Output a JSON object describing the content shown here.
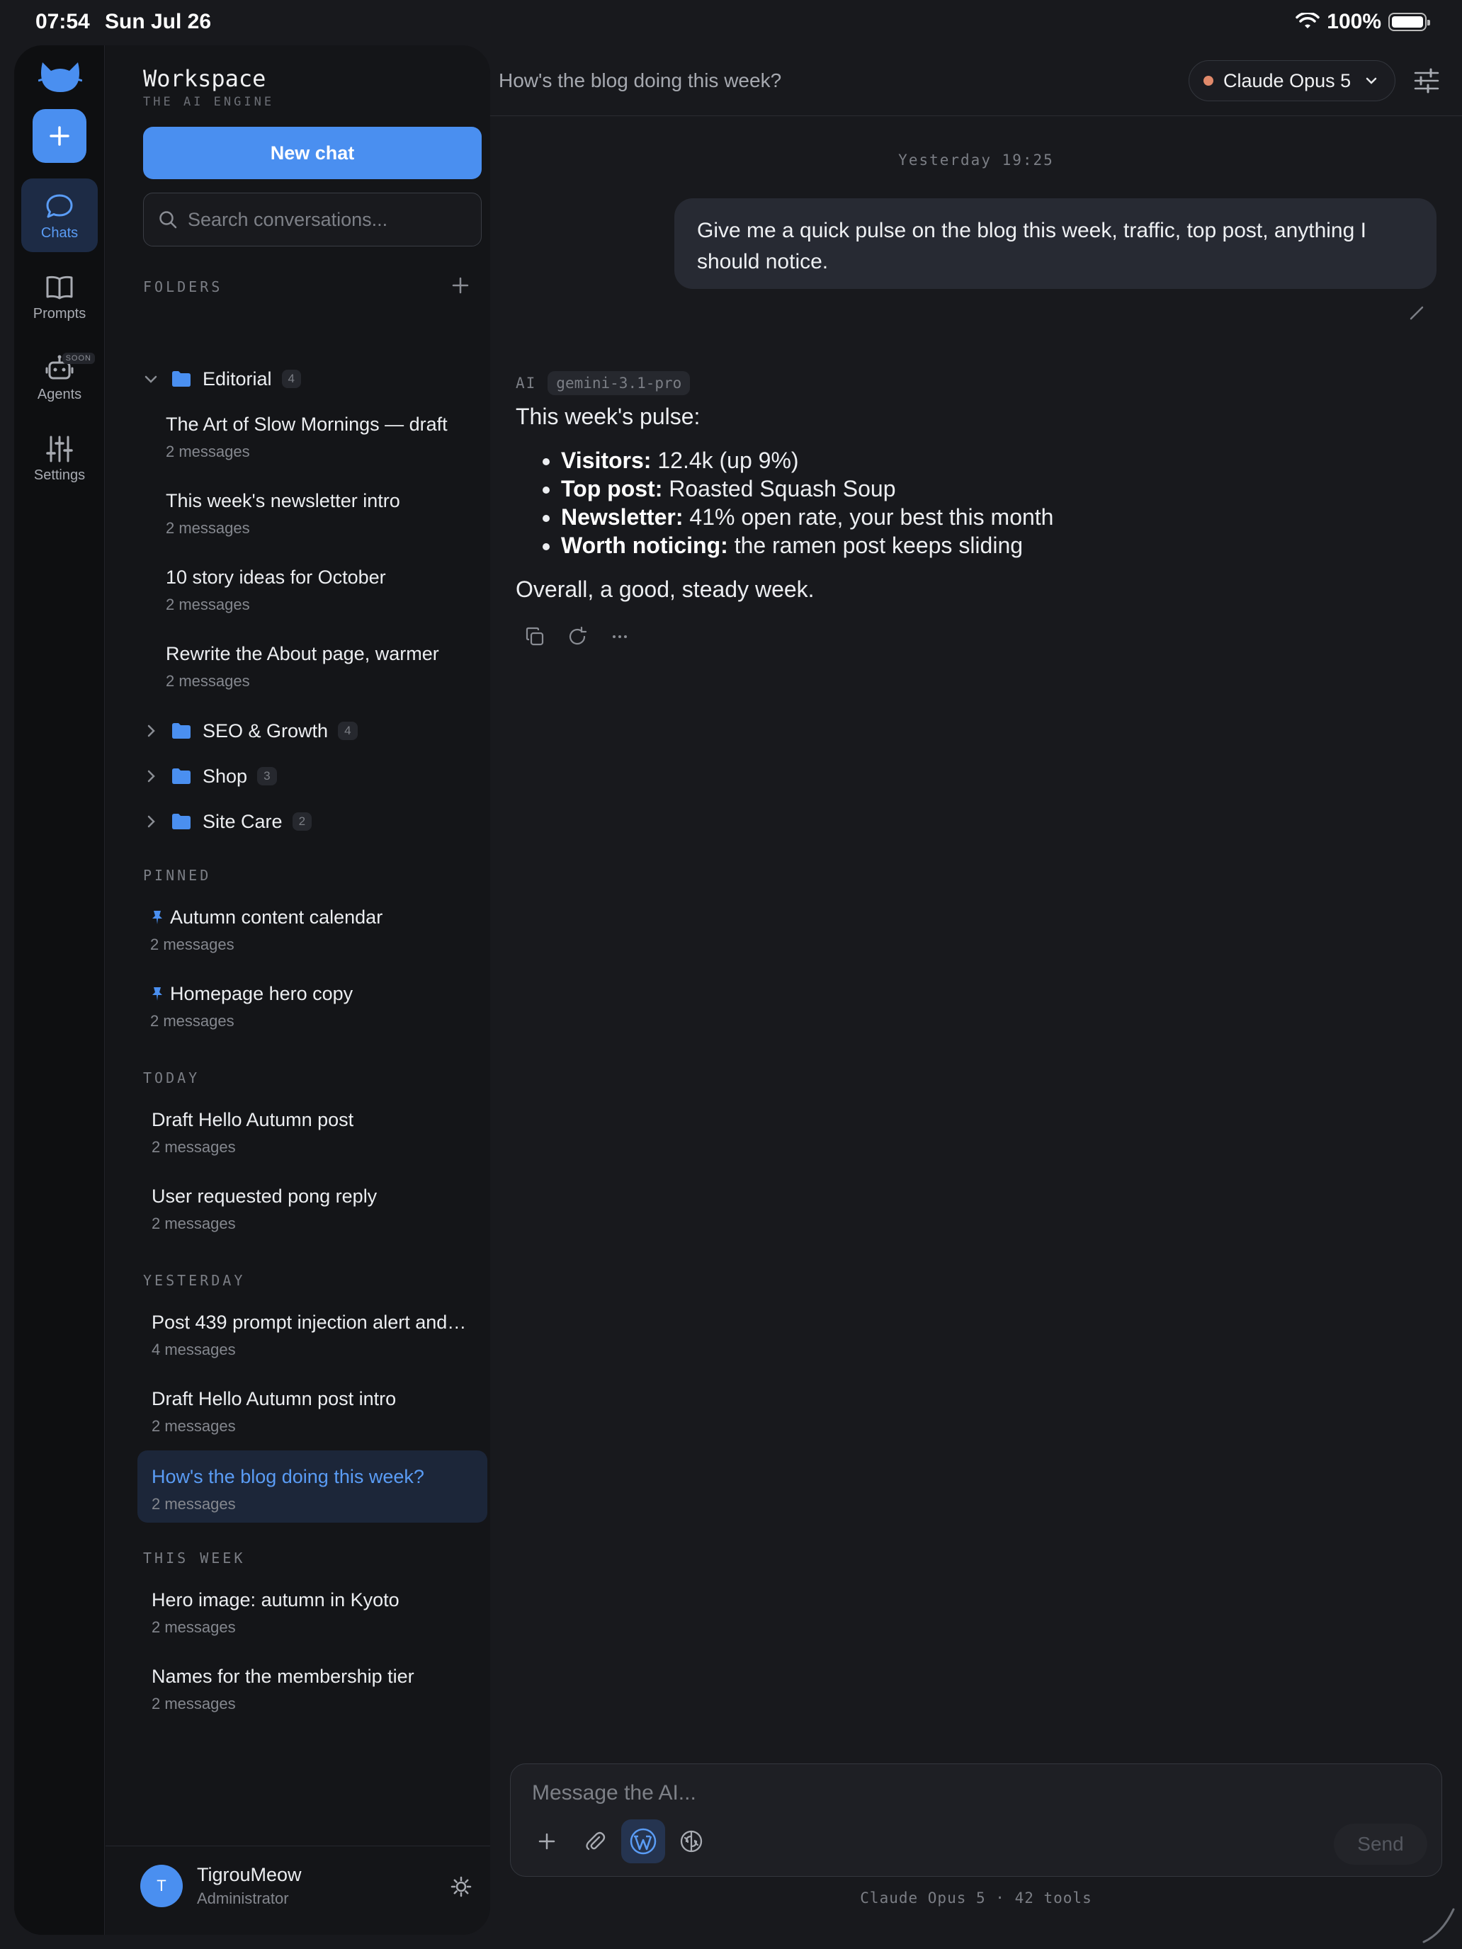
{
  "status_bar": {
    "time": "07:54",
    "date": "Sun Jul 26",
    "battery_text": "100%",
    "battery_level": 1.0
  },
  "rail": {
    "items": [
      {
        "label": "Chats",
        "icon": "chat-bubble-icon",
        "active": true
      },
      {
        "label": "Prompts",
        "icon": "book-icon"
      },
      {
        "label": "Agents",
        "icon": "robot-icon",
        "badge": "SOON"
      },
      {
        "label": "Settings",
        "icon": "sliders-icon"
      }
    ]
  },
  "sidebar": {
    "workspace_title": "Workspace",
    "workspace_subtitle": "THE AI ENGINE",
    "new_chat_label": "New chat",
    "search_placeholder": "Search conversations...",
    "folders_label": "FOLDERS",
    "folders": [
      {
        "name": "Editorial",
        "count": "4",
        "expanded": true,
        "chats": [
          {
            "title": "The Art of Slow Mornings — draft",
            "meta": "2 messages"
          },
          {
            "title": "This week's newsletter intro",
            "meta": "2 messages"
          },
          {
            "title": "10 story ideas for October",
            "meta": "2 messages"
          },
          {
            "title": "Rewrite the About page, warmer",
            "meta": "2 messages"
          }
        ]
      },
      {
        "name": "SEO & Growth",
        "count": "4",
        "expanded": false
      },
      {
        "name": "Shop",
        "count": "3",
        "expanded": false
      },
      {
        "name": "Site Care",
        "count": "2",
        "expanded": false
      }
    ],
    "pinned_label": "PINNED",
    "pinned": [
      {
        "title": "Autumn content calendar",
        "meta": "2 messages"
      },
      {
        "title": "Homepage hero copy",
        "meta": "2 messages"
      }
    ],
    "today_label": "TODAY",
    "today": [
      {
        "title": "Draft Hello Autumn post",
        "meta": "2 messages"
      },
      {
        "title": "User requested pong reply",
        "meta": "2 messages"
      }
    ],
    "yesterday_label": "YESTERDAY",
    "yesterday": [
      {
        "title": "Post 439 prompt injection alert and…",
        "meta": "4 messages"
      },
      {
        "title": "Draft Hello Autumn post intro",
        "meta": "2 messages"
      },
      {
        "title": "How's the blog doing this week?",
        "meta": "2 messages",
        "selected": true
      }
    ],
    "this_week_label": "THIS WEEK",
    "this_week": [
      {
        "title": "Hero image: autumn in Kyoto",
        "meta": "2 messages"
      },
      {
        "title": "Names for the membership tier",
        "meta": "2 messages"
      }
    ],
    "user": {
      "initial": "T",
      "name": "TigrouMeow",
      "role": "Administrator"
    }
  },
  "header": {
    "conversation_title": "How's the blog doing this week?",
    "model_name": "Claude Opus 5",
    "model_dot_color": "#e0896a"
  },
  "conversation": {
    "timestamp": "Yesterday 19:25",
    "user_message": "Give me a quick pulse on the blog this week, traffic, top post, anything I should notice.",
    "ai_label": "AI",
    "ai_model_tag": "gemini-3.1-pro",
    "ai_intro": "This week's pulse:",
    "ai_bullets": [
      {
        "key": "Visitors:",
        "value": " 12.4k (up 9%)"
      },
      {
        "key": "Top post:",
        "value": " Roasted Squash Soup"
      },
      {
        "key": "Newsletter:",
        "value": " 41% open rate, your best this month"
      },
      {
        "key": "Worth noticing:",
        "value": " the ramen post keeps sliding"
      }
    ],
    "ai_outro": "Overall, a good, steady week."
  },
  "composer": {
    "placeholder": "Message the AI...",
    "send_label": "Send",
    "footer": "Claude Opus 5 · 42 tools"
  },
  "colors": {
    "accent": "#4a8ff0",
    "background": "#18191d",
    "sidebar": "#141518"
  }
}
